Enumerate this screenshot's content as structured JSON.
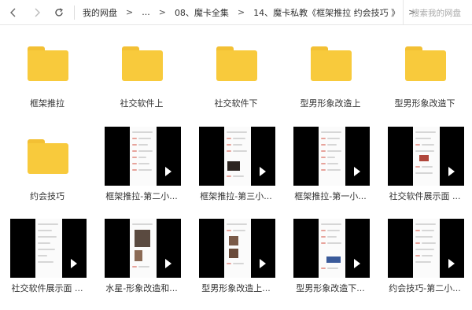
{
  "toolbar": {
    "breadcrumb": [
      "我的网盘",
      "...",
      "08、魔卡全集",
      "14、魔卡私教《框架推拉 约会技巧 》"
    ],
    "search_placeholder": "搜索我的网盘"
  },
  "folders": [
    {
      "name": "框架推拉"
    },
    {
      "name": "社交软件上"
    },
    {
      "name": "社交软件下"
    },
    {
      "name": "型男形象改造上"
    },
    {
      "name": "型男形象改造下"
    },
    {
      "name": "约会技巧"
    }
  ],
  "videos": [
    {
      "name": "框架推拉-第二小..."
    },
    {
      "name": "框架推拉-第三小..."
    },
    {
      "name": "框架推拉-第一小..."
    },
    {
      "name": "社交软件展示面 ..."
    },
    {
      "name": "社交软件展示面 ..."
    },
    {
      "name": "水星-形象改造和..."
    },
    {
      "name": "型男形象改造上..."
    },
    {
      "name": "型男形象改造下..."
    },
    {
      "name": "约会技巧-第二小..."
    }
  ]
}
